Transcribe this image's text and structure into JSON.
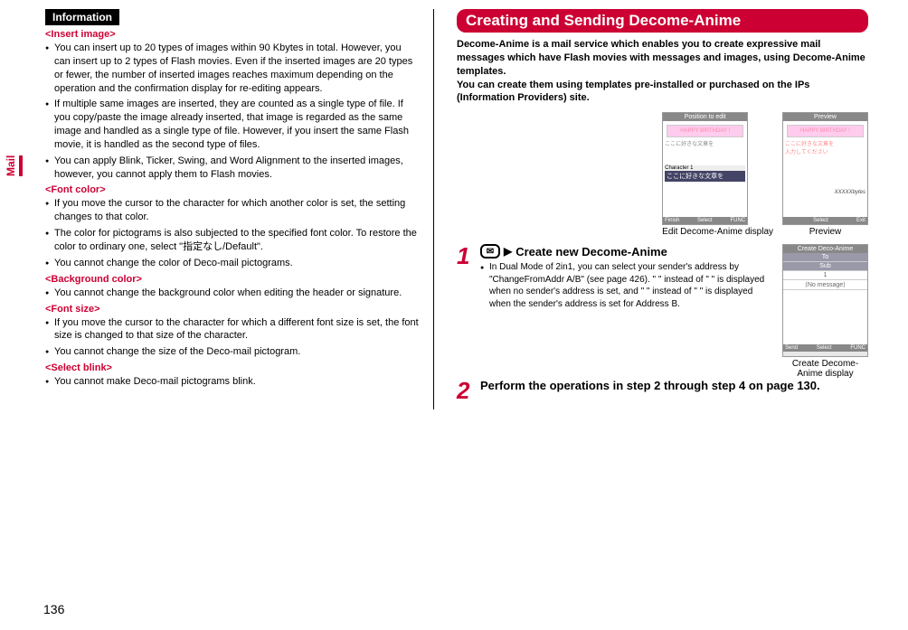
{
  "tab": "Mail",
  "pageNum": "136",
  "left": {
    "infoHeader": "Information",
    "sections": [
      {
        "label": "<Insert image>",
        "bullets": [
          "You can insert up to 20 types of images within 90 Kbytes in total. However, you can insert up to 2 types of Flash movies. Even if the inserted images are 20 types or fewer, the number of inserted images reaches maximum depending on the operation and the confirmation display for re-editing appears.",
          "If multiple same images are inserted, they are counted as a single type of file. If you copy/paste the image already inserted, that image is regarded as the same image and handled as a single type of file. However, if you insert the same Flash movie, it is handled as the second type of files.",
          "You can apply Blink, Ticker, Swing, and Word Alignment to the inserted images, however, you cannot apply them to Flash movies."
        ]
      },
      {
        "label": "<Font color>",
        "bullets": [
          "If you move the cursor to the character for which another color is set, the setting changes to that color.",
          "The color for pictograms is also subjected to the specified font color. To restore the color to ordinary one, select \"指定なし/Default\".",
          "You cannot change the color of Deco-mail pictograms."
        ]
      },
      {
        "label": "<Background color>",
        "bullets": [
          "You cannot change the background color when editing the header or signature."
        ]
      },
      {
        "label": "<Font size>",
        "bullets": [
          "If you move the cursor to the character for which a different font size is set, the font size is changed to that size of the character.",
          "You cannot change the size of the Deco-mail pictogram."
        ]
      },
      {
        "label": "<Select blink>",
        "bullets": [
          "You cannot make Deco-mail pictograms blink."
        ]
      }
    ]
  },
  "right": {
    "title": "Creating and Sending Decome-Anime",
    "intro": "Decome-Anime is a mail service which enables you to create expressive mail messages which have Flash movies with messages and images, using Decome-Anime templates.\nYou can create them using templates pre-installed or purchased on the IPs (Information Providers) site.",
    "shot1": {
      "topbar": "Position to edit",
      "birthday": "HAPPY BIRTHDAY !",
      "jp": "ここに好きな文章を",
      "char": "Character 1",
      "prev": "ここに好きな文章を",
      "btnL": "Finish",
      "btnM": "Select",
      "btnR": "FUNC",
      "caption": "Edit Decome-Anime display"
    },
    "shot2": {
      "topbar": "Preview",
      "birthday": "HAPPY BIRTHDAY !",
      "jp": "ここに好きな文章を\n入力してください",
      "bytes": "XXXXXbytes",
      "btnM": "Select",
      "btnR": "Exit",
      "caption": "Preview"
    },
    "step1": {
      "num": "1",
      "title": "Create new Decome-Anime",
      "detail": "In Dual Mode of 2in1, you can select your sender's address by \"ChangeFromAddr A/B\" (see page 426). \" \" instead of \" \" is displayed when no sender's address is set, and \" \" instead of \" \" is displayed when the sender's address is set for Address B."
    },
    "createShot": {
      "topbar": "Create Deco-Anime",
      "rowTo": "To",
      "rowSub": "Sub",
      "row1": "1",
      "rowMsg": "⟨No message⟩",
      "btnL": "Send",
      "btnM": "Select",
      "btnR": "FUNC",
      "caption": "Create Decome-Anime display"
    },
    "step2": {
      "num": "2",
      "title": "Perform the operations in step 2 through step 4 on page 130."
    }
  }
}
